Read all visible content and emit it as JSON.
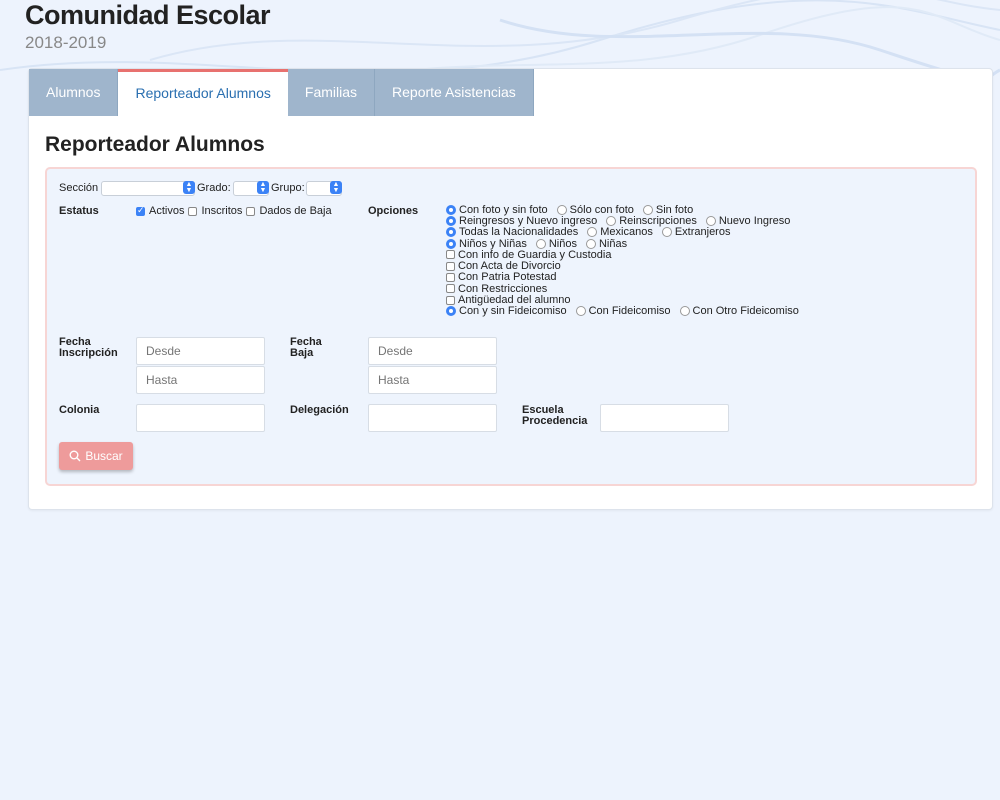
{
  "header": {
    "title": "Comunidad Escolar",
    "year": "2018-2019"
  },
  "tabs": [
    {
      "label": "Alumnos"
    },
    {
      "label": "Reporteador Alumnos"
    },
    {
      "label": "Familias"
    },
    {
      "label": "Reporte Asistencias"
    }
  ],
  "active_tab": "Reporteador Alumnos",
  "section_title": "Reporteador Alumnos",
  "filters": {
    "seccion_label": "Sección",
    "grado_label": "Grado:",
    "grupo_label": "Grupo:",
    "estatus_label": "Estatus",
    "estatus": [
      {
        "label": "Activos",
        "checked": true
      },
      {
        "label": "Inscritos",
        "checked": false
      },
      {
        "label": "Dados de Baja",
        "checked": false
      }
    ],
    "opciones_label": "Opciones",
    "opciones": {
      "foto": [
        "Con foto y sin foto",
        "Sólo con foto",
        "Sin foto"
      ],
      "ingreso": [
        "Reingresos y Nuevo ingreso",
        "Reinscripciones",
        "Nuevo Ingreso"
      ],
      "nacionalidad": [
        "Todas la Nacionalidades",
        "Mexicanos",
        "Extranjeros"
      ],
      "genero": [
        "Niños y Niñas",
        "Niños",
        "Niñas"
      ],
      "checks": [
        "Con info de Guardia y Custodia",
        "Con Acta de Divorcio",
        "Con Patria Potestad",
        "Con Restricciones",
        "Antigüedad del alumno"
      ],
      "fideicomiso": [
        "Con y sin Fideicomiso",
        "Con Fideicomiso",
        "Con Otro Fideicomiso"
      ]
    },
    "fecha_inscripcion_label_1": "Fecha",
    "fecha_inscripcion_label_2": "Inscripción",
    "fecha_baja_label_1": "Fecha",
    "fecha_baja_label_2": "Baja",
    "desde_placeholder": "Desde",
    "hasta_placeholder": "Hasta",
    "colonia_label": "Colonia",
    "delegacion_label": "Delegación",
    "escuela_label_1": "Escuela",
    "escuela_label_2": "Procedencia",
    "search_button": "Buscar"
  },
  "icons": {
    "search": "search-icon"
  },
  "colors": {
    "accent": "#3b82f6",
    "tab_inactive": "#9fb5cc",
    "tab_active_border": "#e8716f",
    "button": "#ee9b9b"
  }
}
